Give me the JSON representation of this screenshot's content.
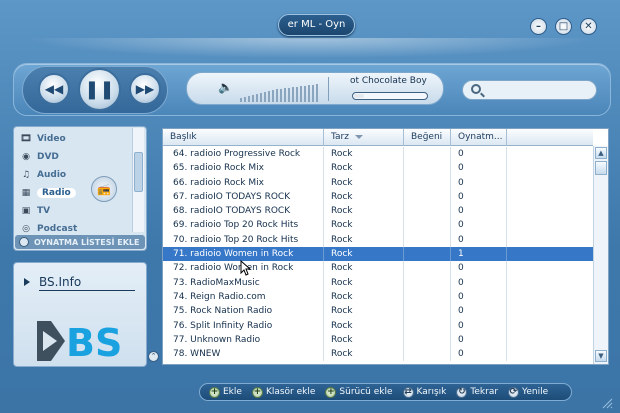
{
  "window": {
    "title": "er ML - Oyn",
    "minimize_icon": "minimize-icon",
    "maximize_icon": "maximize-icon",
    "close_icon": "close-icon"
  },
  "player": {
    "now_playing": "ot Chocolate Boy",
    "progress_value": 0.14,
    "search_placeholder": "",
    "volume_level": 0.35
  },
  "sidebar": {
    "items": [
      {
        "label": "Video",
        "icon": "video-icon"
      },
      {
        "label": "DVD",
        "icon": "dvd-icon"
      },
      {
        "label": "Audio",
        "icon": "audio-icon"
      },
      {
        "label": "Radio",
        "icon": "radio-icon",
        "active": true
      },
      {
        "label": "TV",
        "icon": "tv-icon"
      },
      {
        "label": "Podcast",
        "icon": "podcast-icon"
      }
    ],
    "add_playlist_label": "OYNATMA LİSTESİ EKLE"
  },
  "info": {
    "title": "BS.Info",
    "logo_text": "BS"
  },
  "table": {
    "columns": [
      "Başlık",
      "Tarz",
      "Beğeni",
      "Oynatm..."
    ],
    "rows": [
      {
        "title": "64. radioio Progressive Rock",
        "genre": "Rock",
        "rating": "",
        "plays": "0"
      },
      {
        "title": "65. radioio Rock Mix",
        "genre": "Rock",
        "rating": "",
        "plays": "0"
      },
      {
        "title": "66. radioio Rock Mix",
        "genre": "Rock",
        "rating": "",
        "plays": "0"
      },
      {
        "title": "67. radioIO TODAYS ROCK",
        "genre": "Rock",
        "rating": "",
        "plays": "0"
      },
      {
        "title": "68. radioIO TODAYS ROCK",
        "genre": "Rock",
        "rating": "",
        "plays": "0"
      },
      {
        "title": "69. radioio Top 20 Rock Hits",
        "genre": "Rock",
        "rating": "",
        "plays": "0"
      },
      {
        "title": "70. radioio Top 20 Rock Hits",
        "genre": "Rock",
        "rating": "",
        "plays": "0"
      },
      {
        "title": "71. radioio Women in Rock",
        "genre": "Rock",
        "rating": "",
        "plays": "1",
        "selected": true
      },
      {
        "title": "72. radioio Women in Rock",
        "genre": "Rock",
        "rating": "",
        "plays": "0"
      },
      {
        "title": "73. RadioMaxMusic",
        "genre": "Rock",
        "rating": "",
        "plays": "0"
      },
      {
        "title": "74. Reign Radio.com",
        "genre": "Rock",
        "rating": "",
        "plays": "0"
      },
      {
        "title": "75. Rock Nation Radio",
        "genre": "Rock",
        "rating": "",
        "plays": "0"
      },
      {
        "title": "76. Split Infinity Radio",
        "genre": "Rock",
        "rating": "",
        "plays": "0"
      },
      {
        "title": "77. Unknown Radio",
        "genre": "Rock",
        "rating": "",
        "plays": "0"
      },
      {
        "title": "78. WNEW",
        "genre": "Rock",
        "rating": "",
        "plays": "0"
      }
    ]
  },
  "toolbar": {
    "add": "Ekle",
    "add_folder": "Klasör ekle",
    "add_drive": "Sürücü ekle",
    "shuffle": "Karışık",
    "repeat": "Tekrar",
    "refresh": "Yenile"
  },
  "colors": {
    "selection": "#3677c8",
    "panel": "#4a83b4",
    "logo_blue": "#1aa2e0"
  }
}
